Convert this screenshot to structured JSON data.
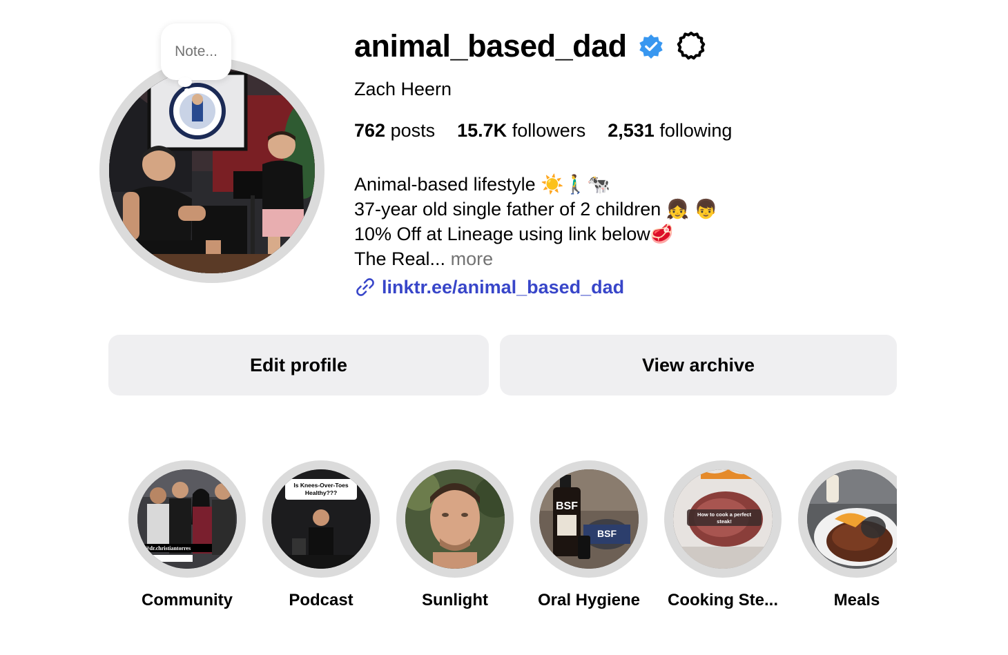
{
  "profile": {
    "username": "animal_based_dad",
    "full_name": "Zach Heern",
    "note_placeholder": "Note...",
    "stats": {
      "posts_count": "762",
      "posts_label": "posts",
      "followers_count": "15.7K",
      "followers_label": "followers",
      "following_count": "2,531",
      "following_label": "following"
    },
    "bio": {
      "line1": "Animal-based lifestyle ☀️🚶‍♂️🐄",
      "line2": "37-year old single father of 2 children 👧 👦",
      "line3": "10% Off at Lineage using link below🥩",
      "line4": "The Real...",
      "more_label": "more"
    },
    "link": "linktr.ee/animal_based_dad"
  },
  "actions": {
    "edit_profile": "Edit profile",
    "view_archive": "View archive"
  },
  "highlights": [
    {
      "label": "Community",
      "thumb_text": "@dr.christiantorres"
    },
    {
      "label": "Podcast",
      "thumb_text": "Is Knees-Over-Toes Healthy???"
    },
    {
      "label": "Sunlight"
    },
    {
      "label": "Oral Hygiene",
      "thumb_text": "BSF"
    },
    {
      "label": "Cooking Ste...",
      "thumb_text": "How to cook a perfect steak!"
    },
    {
      "label": "Meals"
    }
  ],
  "icons": {
    "verified": "verified-badge-icon",
    "settings": "gear-icon",
    "link": "link-icon"
  },
  "colors": {
    "verified_blue": "#3897f0",
    "link_blue": "#3846c9",
    "button_bg": "#efeff1",
    "muted_text": "#737373",
    "ring_gray": "#dbdbdb"
  }
}
